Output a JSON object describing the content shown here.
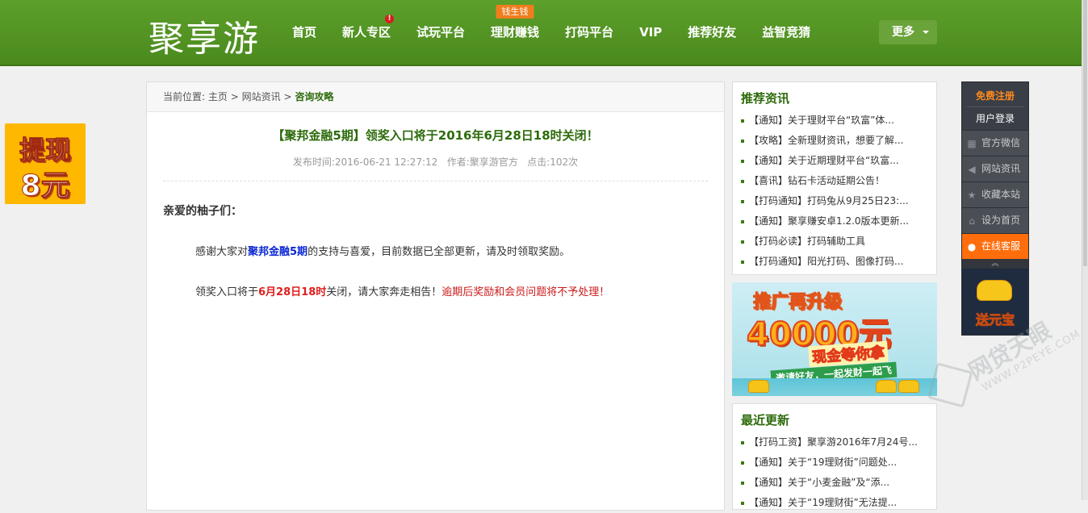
{
  "header": {
    "logo": "聚享游",
    "nav": [
      {
        "label": "首页"
      },
      {
        "label": "新人专区",
        "dot": "!"
      },
      {
        "label": "试玩平台"
      },
      {
        "label": "理财赚钱",
        "badge": "钱生钱"
      },
      {
        "label": "打码平台"
      },
      {
        "label": "VIP"
      },
      {
        "label": "推荐好友"
      },
      {
        "label": "益智竞猜"
      }
    ],
    "more_label": "更多"
  },
  "left_promo": {
    "line1": "提现",
    "line2": "8元"
  },
  "breadcrumb": {
    "prefix": "当前位置:",
    "home": "主页",
    "sep": ">",
    "section": "网站资讯",
    "current": "咨询攻略"
  },
  "article": {
    "title": "【聚邦金融5期】领奖入口将于2016年6月28日18时关闭！",
    "meta": "发布时间:2016-06-21 12:27:12   作者:聚享游官方   点击:102次",
    "greeting": "亲爱的柚子们：",
    "p1_before": "感谢大家对",
    "p1_highlight": "聚邦金融5期",
    "p1_after": "的支持与喜爱，目前数据已全部更新，请及时领取奖励。",
    "p2_before": "领奖入口将于",
    "p2_highlight": "6月28日18时",
    "p2_middle": "关闭，请大家奔走相告！",
    "p2_warning": "逾期后奖励和会员问题将不予处理！"
  },
  "recommended": {
    "title": "推荐资讯",
    "items": [
      "【通知】关于理财平台“玖富”体...",
      "【攻略】全新理财资讯，想要了解...",
      "【通知】关于近期理财平台“玖富...",
      "【喜讯】钻石卡活动延期公告！",
      "【打码通知】打码兔从9月25日23:...",
      "【通知】聚享赚安卓1.2.0版本更新...",
      "【打码必读】打码辅助工具",
      "【打码通知】阳光打码、图像打码..."
    ]
  },
  "banner": {
    "line1": "推广再升级",
    "line2": "40000元",
    "line3": "现金等你拿",
    "line4": "邀请好友，一起发财一起飞"
  },
  "latest": {
    "title": "最近更新",
    "items": [
      "【打码工资】聚享游2016年7月24号...",
      "【通知】关于“19理财街”问题处...",
      "【通知】关于“小麦金融”及“添...",
      "【通知】关于“19理财街”无法提..."
    ]
  },
  "sidebar": {
    "register": "免费注册",
    "login": "用户登录",
    "rows": [
      {
        "label": "官方微信",
        "icon": "qrcode-icon",
        "glyph": "▦"
      },
      {
        "label": "网站资讯",
        "icon": "speaker-icon",
        "glyph": "◀"
      },
      {
        "label": "收藏本站",
        "icon": "star-icon",
        "glyph": "★"
      },
      {
        "label": "设为首页",
        "icon": "home-icon",
        "glyph": "⌂"
      },
      {
        "label": "在线客服",
        "icon": "qq-icon",
        "glyph": "●"
      }
    ],
    "up": "︽",
    "yuanbao": "送元宝"
  },
  "watermark": {
    "name": "网贷天眼",
    "url": "WWW.P2PEYE.COM"
  }
}
